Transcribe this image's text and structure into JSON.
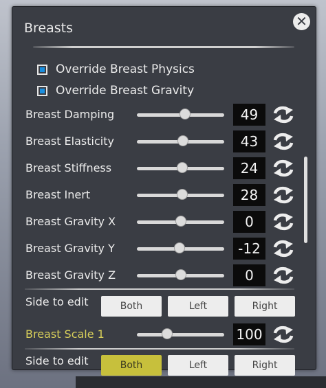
{
  "panel": {
    "title": "Breasts",
    "close_icon": "close-icon"
  },
  "toggles": [
    {
      "label": "Override Breast Physics",
      "checked": true
    },
    {
      "label": "Override Breast Gravity",
      "checked": true
    }
  ],
  "sliders": [
    {
      "label": "Breast Damping",
      "value": "49",
      "level": 0.55
    },
    {
      "label": "Breast Elasticity",
      "value": "43",
      "level": 0.53
    },
    {
      "label": "Breast Stiffness",
      "value": "24",
      "level": 0.52
    },
    {
      "label": "Breast Inert",
      "value": "28",
      "level": 0.52
    },
    {
      "label": "Breast Gravity X",
      "value": "0",
      "level": 0.5
    },
    {
      "label": "Breast Gravity Y",
      "value": "-12",
      "level": 0.49
    },
    {
      "label": "Breast Gravity Z",
      "value": "0",
      "level": 0.5
    }
  ],
  "side_to_edit_1": {
    "label": "Side to edit",
    "options": [
      "Both",
      "Left",
      "Right"
    ],
    "selected": "Both"
  },
  "scale": {
    "label": "Breast Scale 1",
    "value": "100",
    "level": 0.35
  },
  "side_to_edit_2": {
    "label": "Side to edit",
    "options": [
      "Both",
      "Left",
      "Right"
    ],
    "selected": "Both"
  },
  "colors": {
    "panel_bg": "#3a3d44",
    "accent": "#c7c03c",
    "checkbox": "#1a8fe0"
  }
}
